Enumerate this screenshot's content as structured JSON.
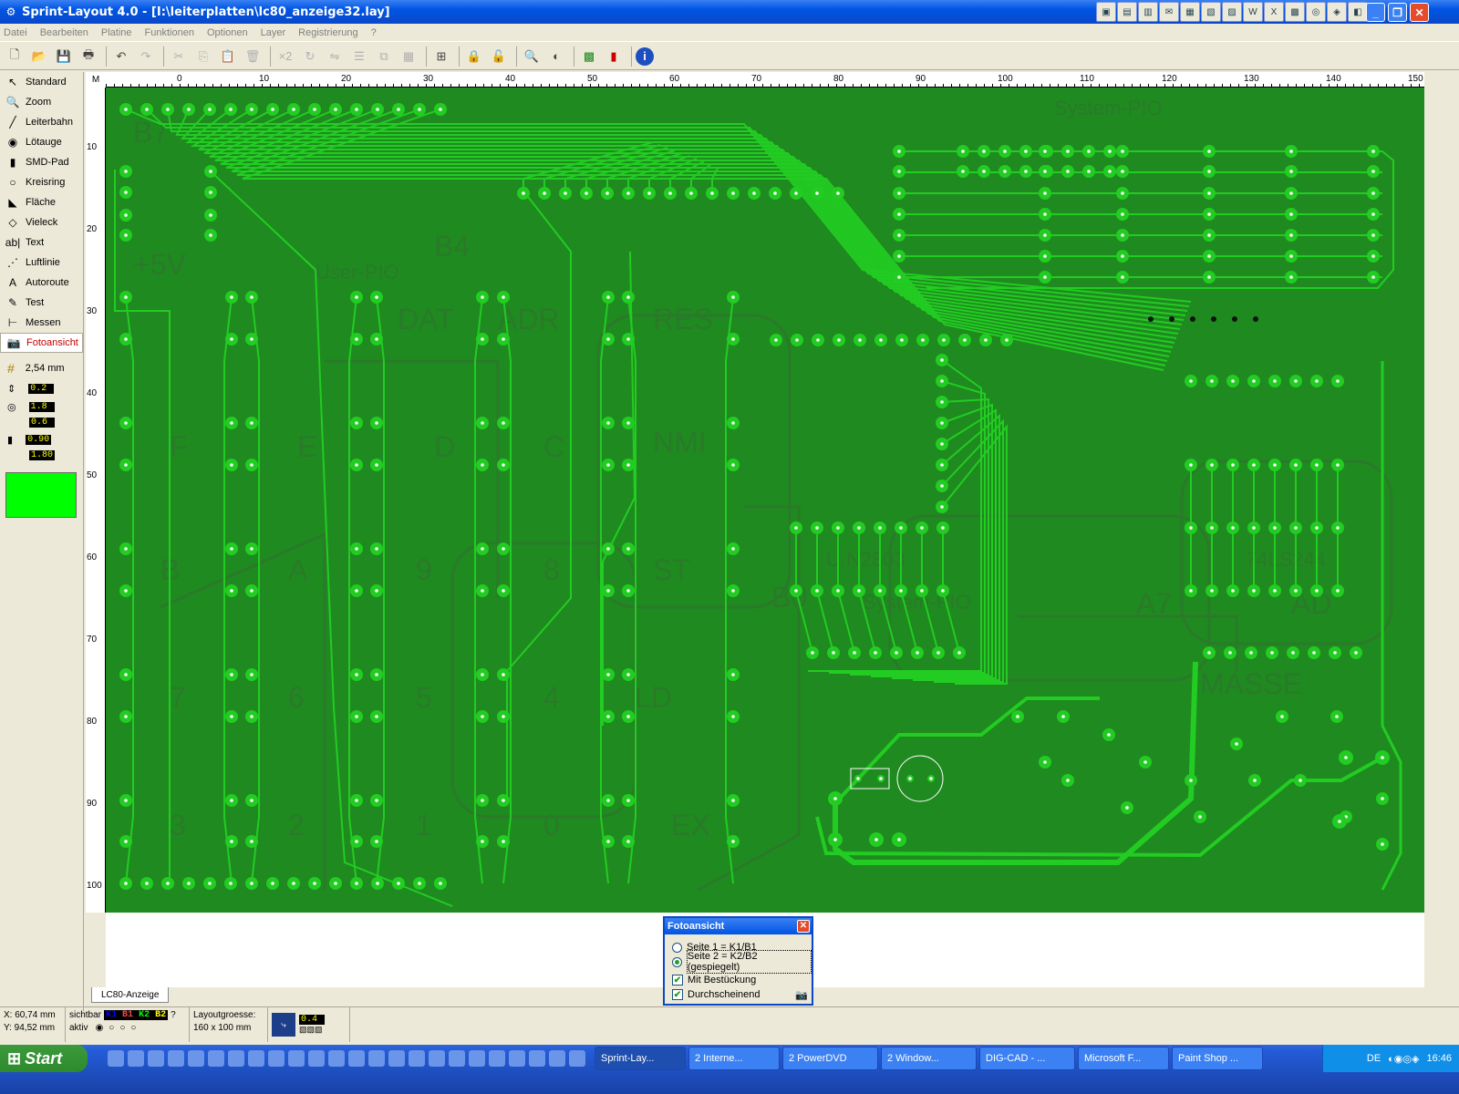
{
  "window": {
    "title": "Sprint-Layout 4.0 - [I:\\leiterplatten\\lc80_anzeige32.lay]"
  },
  "menu": [
    "Datei",
    "Bearbeiten",
    "Platine",
    "Funktionen",
    "Optionen",
    "Layer",
    "Registrierung",
    "?"
  ],
  "toolbar": {
    "icons": [
      "new-icon",
      "open-icon",
      "save-icon",
      "print-icon",
      "undo-icon",
      "redo-icon",
      "cut-icon",
      "copy-icon",
      "paste-icon",
      "delete-icon",
      "multiply-icon",
      "rotate-icon",
      "mirror-icon",
      "align-icon",
      "group-icon",
      "ungroup-icon",
      "macro-icon",
      "lock-icon",
      "unlock-icon",
      "zoom-icon",
      "contrast-icon",
      "drc-icon",
      "macro-lib-icon",
      "info-icon"
    ],
    "multiply_label": "×2"
  },
  "tools": [
    {
      "label": "Standard",
      "icon": "arrow-icon",
      "glyph": "↖"
    },
    {
      "label": "Zoom",
      "icon": "zoom-icon",
      "glyph": "🔍"
    },
    {
      "label": "Leiterbahn",
      "icon": "track-icon",
      "glyph": "╱"
    },
    {
      "label": "Lötauge",
      "icon": "pad-icon",
      "glyph": "◉"
    },
    {
      "label": "SMD-Pad",
      "icon": "smd-pad-icon",
      "glyph": "▮"
    },
    {
      "label": "Kreisring",
      "icon": "circle-icon",
      "glyph": "○"
    },
    {
      "label": "Fläche",
      "icon": "area-icon",
      "glyph": "◣"
    },
    {
      "label": "Vieleck",
      "icon": "polygon-icon",
      "glyph": "◇"
    },
    {
      "label": "Text",
      "icon": "text-icon",
      "glyph": "ab|"
    },
    {
      "label": "Luftlinie",
      "icon": "airwire-icon",
      "glyph": "⋰"
    },
    {
      "label": "Autoroute",
      "icon": "autoroute-icon",
      "glyph": "A"
    },
    {
      "label": "Test",
      "icon": "test-icon",
      "glyph": "✎"
    },
    {
      "label": "Messen",
      "icon": "measure-icon",
      "glyph": "⊢"
    },
    {
      "label": "Fotoansicht",
      "icon": "camera-icon",
      "glyph": "📷"
    }
  ],
  "grid": {
    "value": "2,54 mm"
  },
  "params": {
    "track_width": "0.2",
    "pad_outer": "1.8",
    "pad_inner": "0.6",
    "smd_w": "0.90",
    "smd_h": "1.80"
  },
  "colors": {
    "board": "#1F8A1F",
    "copper": "#22CC22",
    "swatch": "#00FF00"
  },
  "ruler": {
    "top": [
      "0",
      "10",
      "20",
      "30",
      "40",
      "50",
      "60",
      "70",
      "80",
      "90",
      "100",
      "110",
      "120",
      "130",
      "140",
      "150"
    ],
    "left": [
      "10",
      "20",
      "30",
      "40",
      "50",
      "60",
      "70",
      "80",
      "90",
      "100"
    ],
    "unit_button": "M"
  },
  "board_text": [
    "System-PIO",
    "User-PIO",
    "B7",
    "B4",
    "+5V",
    "DAT",
    "ADR",
    "RES",
    "NMI",
    "D",
    "E",
    "F",
    "C",
    "B",
    "A",
    "9",
    "8",
    "ST",
    "7",
    "6",
    "5",
    "4",
    "LD",
    "3",
    "2",
    "1",
    "0",
    "EX",
    "74LS244",
    "U.N2803",
    "System-PIO",
    "MASSE",
    "A7",
    "AD",
    "B0"
  ],
  "tab": {
    "label": "LC80-Anzeige"
  },
  "status": {
    "x": "X: 60,74 mm",
    "y": "Y: 94,52 mm",
    "visible_label": "sichtbar",
    "active_label": "aktiv",
    "layers": [
      "K1",
      "B1",
      "K2",
      "B2"
    ],
    "question": "?",
    "size_label": "Layoutgroesse:",
    "size_value": "160 x 100 mm",
    "zoom_value": "0.4"
  },
  "dialog": {
    "title": "Fotoansicht",
    "radio1": "Seite 1 = K1/B1",
    "radio2": "Seite 2 = K2/B2 (gespiegelt)",
    "check1": "Mit Bestückung",
    "check2": "Durchscheinend",
    "selected": 2
  },
  "taskbar": {
    "start": "Start",
    "tasks": [
      "Sprint-Lay...",
      "2 Interne...",
      "2 PowerDVD",
      "2 Window...",
      "DIG-CAD - ...",
      "Microsoft F...",
      "Paint Shop ..."
    ],
    "active_task": 0,
    "lang": "DE",
    "clock": "16:46"
  }
}
